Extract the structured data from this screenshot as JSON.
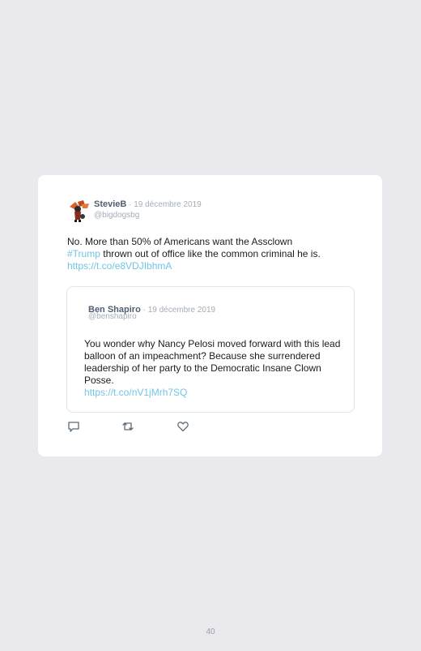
{
  "tweet": {
    "author_name": "StevieB",
    "separator": " · ",
    "date": "19 décembre 2019",
    "handle": "@bigdogsbg",
    "text_before": "No. More than 50% of Americans want the Assclown",
    "hashtag": "#Trump",
    "text_after": " thrown out of office like the common criminal he is.",
    "link": "https://t.co/e8VDJIbhmA"
  },
  "quoted": {
    "author_name": "Ben Shapiro",
    "separator": " · ",
    "date": "19 décembre 2019",
    "handle": "@benshapiro",
    "text": "You wonder why Nancy Pelosi moved forward with this lead balloon of an impeachment? Because she surrendered leadership of her party to the Democratic Insane Clown Posse.",
    "link": "https://t.co/nV1jMrh7SQ"
  },
  "actions": {
    "reply_icon": "comment-icon",
    "retweet_icon": "retweet-icon",
    "like_icon": "heart-icon"
  },
  "footer": {
    "page_number": "40"
  },
  "colors": {
    "background": "#e9e9ee",
    "card": "#ffffff",
    "link": "#72c4e6",
    "name": "#4f6073",
    "muted": "#a3adb8"
  }
}
